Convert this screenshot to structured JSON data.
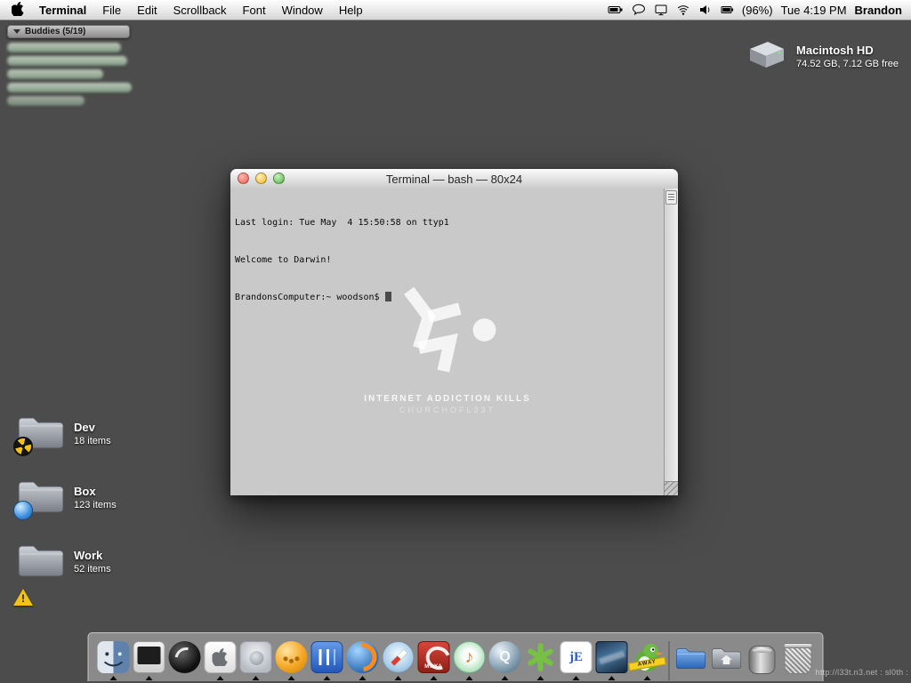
{
  "menubar": {
    "app_name": "Terminal",
    "menus": [
      "File",
      "Edit",
      "Scrollback",
      "Font",
      "Window",
      "Help"
    ],
    "battery_pct": "(96%)",
    "clock": "Tue 4:19 PM",
    "user": "Brandon"
  },
  "buddies": {
    "title": "Buddies (5/19)"
  },
  "drive": {
    "name": "Macintosh HD",
    "info": "74.52 GB, 7.12 GB free"
  },
  "terminal_window": {
    "title": "Terminal — bash — 80x24",
    "lines": [
      "Last login: Tue May  4 15:50:58 on ttyp1",
      "Welcome to Darwin!"
    ],
    "prompt": "BrandonsComputer:~ woodson$",
    "watermark_title": "INTERNET ADDICTION KILLS",
    "watermark_subtitle": "CHURCHOFL33T"
  },
  "folders": [
    {
      "name": "Dev",
      "count": "18 items"
    },
    {
      "name": "Box",
      "count": "123 items"
    },
    {
      "name": "Work",
      "count": "52 items"
    }
  ],
  "dock": {
    "apps": [
      {
        "label": "Finder",
        "running": true
      },
      {
        "label": "Terminal",
        "running": true
      },
      {
        "label": "Disc Player",
        "running": false
      },
      {
        "label": "TextEdit",
        "running": true
      },
      {
        "label": "System Preferences",
        "running": true
      },
      {
        "label": "LaunchBar",
        "running": true
      },
      {
        "label": "Mail",
        "running": true
      },
      {
        "label": "Firefox",
        "running": true
      },
      {
        "label": "Safari",
        "running": true
      },
      {
        "label": "Maya",
        "running": true
      },
      {
        "label": "iTunes",
        "running": true
      },
      {
        "label": "Quicksilver",
        "running": true
      },
      {
        "label": "Green App",
        "running": true
      },
      {
        "label": "jEdit",
        "running": true
      },
      {
        "label": "Image Viewer",
        "running": true
      },
      {
        "label": "Adium",
        "running": true
      }
    ],
    "shortcuts": [
      {
        "label": "Documents"
      },
      {
        "label": "Home"
      },
      {
        "label": "Widget"
      },
      {
        "label": "Trash"
      }
    ],
    "maya_text": "MAYA",
    "jedit_text": "jE",
    "away_text": "AWAY",
    "q_text": "Q"
  },
  "corner_text": "http://l33t.n3.net : sl0th :"
}
